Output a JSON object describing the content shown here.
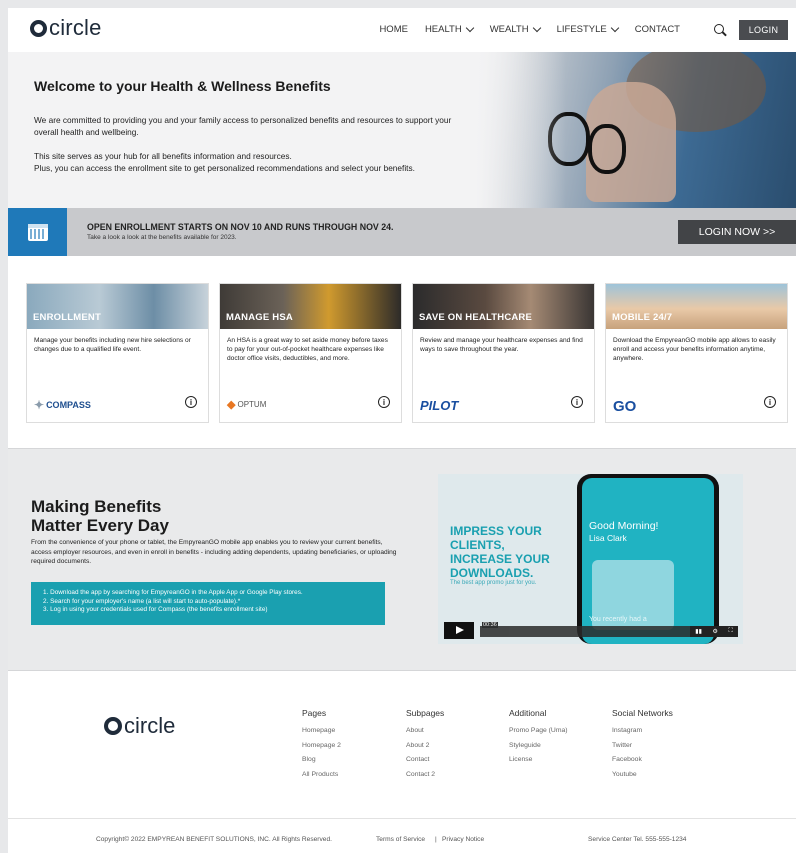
{
  "header": {
    "logo_text": "circle",
    "nav": [
      {
        "label": "HOME",
        "dropdown": false
      },
      {
        "label": "HEALTH",
        "dropdown": true
      },
      {
        "label": "WEALTH",
        "dropdown": true
      },
      {
        "label": "LIFESTYLE",
        "dropdown": true
      },
      {
        "label": "CONTACT",
        "dropdown": false
      }
    ],
    "login_label": "LOGIN"
  },
  "hero": {
    "title": "Welcome to your Health & Wellness Benefits",
    "para1": "We are committed to providing you and your family access to personalized benefits and resources to support your overall health and wellbeing.",
    "para2": "This site serves as your hub for all benefits information and resources.",
    "para3": "Plus, you can access the enrollment site to get personalized recommendations and select your benefits."
  },
  "banner": {
    "title": "OPEN ENROLLMENT STARTS ON NOV 10 AND RUNS THROUGH NOV 24.",
    "subtitle": "Take a look a look at the benefits available for 2023.",
    "button": "LOGIN NOW >>"
  },
  "cards": [
    {
      "label": "ENROLLMENT",
      "desc": "Manage your benefits including new hire selections or changes due to a qualified life event.",
      "brand": "COMPASS",
      "brand_color": "#1f4f8f"
    },
    {
      "label": "MANAGE HSA",
      "desc": "An HSA is a great way to set aside money before taxes to pay for your out-of-pocket healthcare expenses like doctor office visits, deductibles, and more.",
      "brand": "OPTUM",
      "brand_color": "#e87722"
    },
    {
      "label": "SAVE ON HEALTHCARE",
      "desc": "Review and manage your healthcare expenses and find ways to save throughout the year.",
      "brand": "PILOT",
      "brand_color": "#1a4fa0"
    },
    {
      "label": "MOBILE 24/7",
      "desc": "Download the EmpyreanGO mobile app allows to easily enroll and access your benefits information anytime, anywhere.",
      "brand": "GO",
      "brand_color": "#1a4fa0"
    }
  ],
  "making": {
    "title_line1": "Making Benefits",
    "title_line2": "Matter Every Day",
    "text": "From the convenience of your phone or tablet, the EmpyreanGO mobile app enables you to review your current benefits, access employer resources, and even in enroll in benefits - including adding dependents, updating beneficiaries, or uploading required documents.",
    "steps": [
      "1. Download the app by searching for EmpyreanGO in the Apple App or Google Play stores.",
      "2. Search for your employer's name (a list will start to auto-populate).*",
      "3. Log in using your credentials used for Compass (the benefits enrollment site)"
    ]
  },
  "video": {
    "promo_line1": "IMPRESS YOUR",
    "promo_line2": "CLIENTS,",
    "promo_line3": "INCREASE YOUR",
    "promo_line4": "DOWNLOADS.",
    "promo_sub": "The best app promo just for you.",
    "phone_greeting": "Good Morning!",
    "phone_name": "Lisa Clark",
    "phone_msg": "You recently had a",
    "time": "00:36"
  },
  "footer": {
    "logo_text": "circle",
    "columns": [
      {
        "heading": "Pages",
        "links": [
          "Homepage",
          "Homepage 2",
          "Blog",
          "All Products"
        ]
      },
      {
        "heading": "Subpages",
        "links": [
          "About",
          "About 2",
          "Contact",
          "Contact 2"
        ]
      },
      {
        "heading": "Additional",
        "links": [
          "Promo Page (Uma)",
          "Styleguide",
          "License"
        ]
      },
      {
        "heading": "Social Networks",
        "links": [
          "Instagram",
          "Twitter",
          "Facebook",
          "Youtube"
        ]
      }
    ],
    "copyright": "Copyright© 2022 EMPYREAN BENEFIT SOLUTIONS, INC. All Rights Reserved.",
    "terms": "Terms of Service",
    "separator": "|",
    "privacy": "Privacy Notice",
    "service": "Service Center  Tel. 555-555-1234"
  },
  "colors": {
    "accent_blue": "#1f79b9",
    "teal": "#1aa0b0",
    "dark_button": "#424447"
  }
}
